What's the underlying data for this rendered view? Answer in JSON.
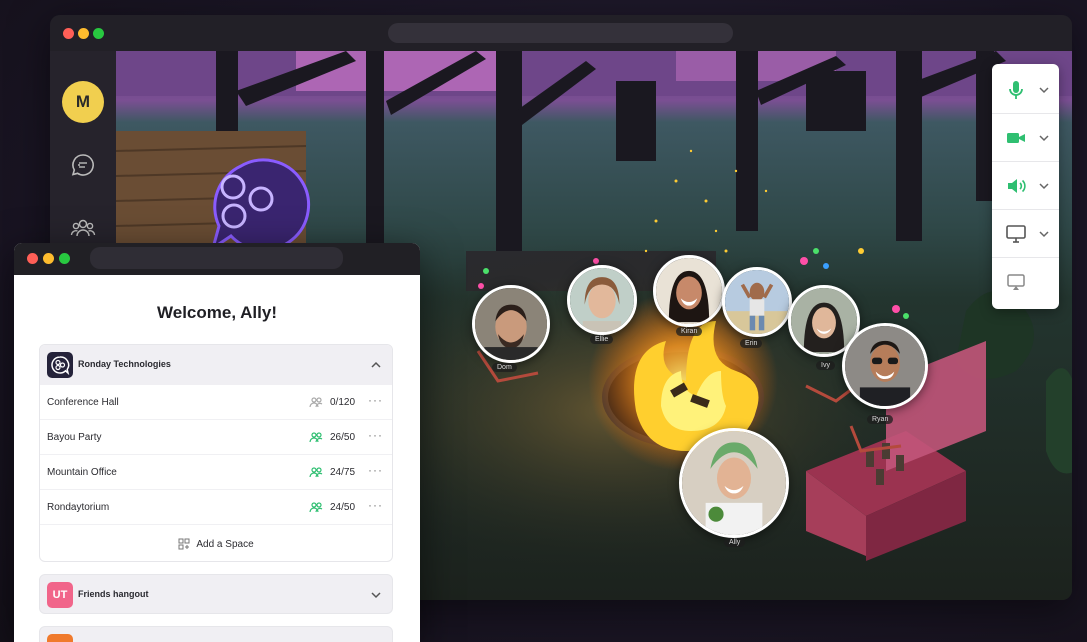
{
  "user": {
    "initial": "M"
  },
  "welcome": {
    "title": "Welcome, Ally!"
  },
  "organizations": [
    {
      "name": "Ronday Technologies",
      "expanded": true,
      "spaces": [
        {
          "name": "Conference Hall",
          "count": "0/120",
          "active": false
        },
        {
          "name": "Bayou Party",
          "count": "26/50",
          "active": true
        },
        {
          "name": "Mountain Office",
          "count": "24/75",
          "active": true
        },
        {
          "name": "Rondaytorium",
          "count": "24/50",
          "active": true
        }
      ],
      "add_space_label": "Add a Space"
    },
    {
      "name": "Friends hangout",
      "badge": "UT",
      "badge_color": "#f1658a",
      "expanded": false
    },
    {
      "name": "",
      "badge_color": "#f07a2c",
      "expanded": false
    }
  ],
  "participants": [
    {
      "name": "Dom"
    },
    {
      "name": "Ellie"
    },
    {
      "name": "Kiran"
    },
    {
      "name": "Erin"
    },
    {
      "name": "Ivy"
    },
    {
      "name": "Ryan"
    },
    {
      "name": "Ally"
    }
  ],
  "controls": [
    {
      "icon": "microphone-icon",
      "color": "#2fbf71"
    },
    {
      "icon": "video-camera-icon",
      "color": "#2fbf71"
    },
    {
      "icon": "speaker-icon",
      "color": "#2fbf71"
    },
    {
      "icon": "screen-share-icon",
      "color": "#555555"
    },
    {
      "icon": "cast-icon",
      "color": "#888888"
    }
  ],
  "colors": {
    "accent_green": "#2fbf71",
    "brand_purple": "#7b3fe4"
  }
}
